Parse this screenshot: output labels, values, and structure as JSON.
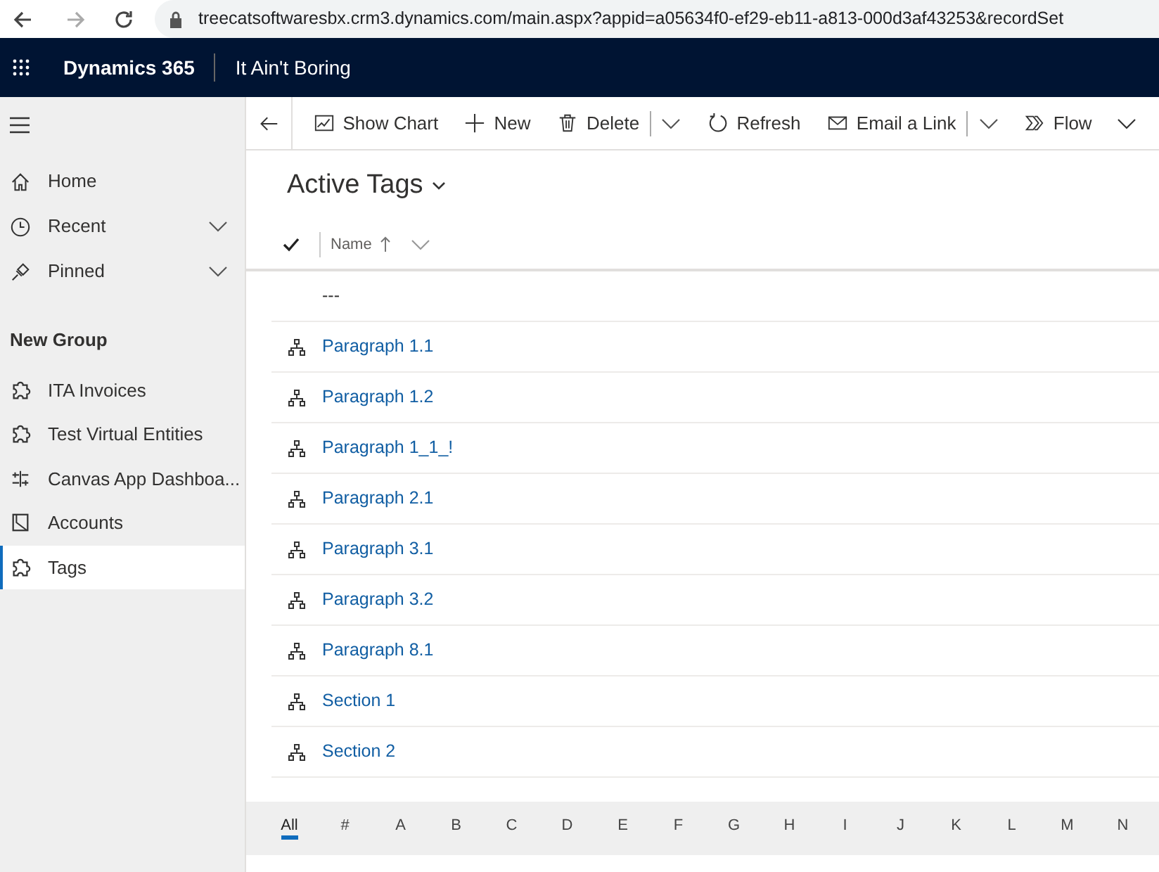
{
  "browser": {
    "url": "treecatsoftwaresbx.crm3.dynamics.com/main.aspx?appid=a05634f0-ef29-eb11-a813-000d3af43253&recordSet"
  },
  "header": {
    "product": "Dynamics 365",
    "app": "It Ain't Boring"
  },
  "sidebar": {
    "items": [
      {
        "label": "Home",
        "chevron": false,
        "selected": false
      },
      {
        "label": "Recent",
        "chevron": true,
        "selected": false
      },
      {
        "label": "Pinned",
        "chevron": true,
        "selected": false
      }
    ],
    "group": "New Group",
    "group_items": [
      {
        "label": "ITA Invoices",
        "selected": false
      },
      {
        "label": "Test Virtual Entities",
        "selected": false
      },
      {
        "label": "Canvas App Dashboa...",
        "selected": false
      },
      {
        "label": "Accounts",
        "selected": false
      },
      {
        "label": "Tags",
        "selected": true
      }
    ]
  },
  "toolbar": [
    {
      "kind": "button",
      "label": "Show Chart"
    },
    {
      "kind": "button",
      "label": "New"
    },
    {
      "kind": "split",
      "label": "Delete"
    },
    {
      "kind": "button",
      "label": "Refresh"
    },
    {
      "kind": "split",
      "label": "Email a Link"
    },
    {
      "kind": "menu",
      "label": "Flow"
    }
  ],
  "view": {
    "title": "Active Tags"
  },
  "table": {
    "columns": [
      "Name"
    ],
    "rows": [
      {
        "name": "---",
        "icon": false
      },
      {
        "name": "Paragraph 1.1",
        "icon": true
      },
      {
        "name": "Paragraph 1.2",
        "icon": true
      },
      {
        "name": "Paragraph 1_1_!",
        "icon": true
      },
      {
        "name": "Paragraph 2.1",
        "icon": true
      },
      {
        "name": "Paragraph 3.1",
        "icon": true
      },
      {
        "name": "Paragraph 3.2",
        "icon": true
      },
      {
        "name": "Paragraph 8.1",
        "icon": true
      },
      {
        "name": "Section 1",
        "icon": true
      },
      {
        "name": "Section 2",
        "icon": true
      }
    ]
  },
  "alphabet": [
    {
      "label": "All",
      "selected": true
    },
    {
      "label": "#",
      "selected": false
    },
    {
      "label": "A",
      "selected": false
    },
    {
      "label": "B",
      "selected": false
    },
    {
      "label": "C",
      "selected": false
    },
    {
      "label": "D",
      "selected": false
    },
    {
      "label": "E",
      "selected": false
    },
    {
      "label": "F",
      "selected": false
    },
    {
      "label": "G",
      "selected": false
    },
    {
      "label": "H",
      "selected": false
    },
    {
      "label": "I",
      "selected": false
    },
    {
      "label": "J",
      "selected": false
    },
    {
      "label": "K",
      "selected": false
    },
    {
      "label": "L",
      "selected": false
    },
    {
      "label": "M",
      "selected": false
    },
    {
      "label": "N",
      "selected": false
    }
  ]
}
